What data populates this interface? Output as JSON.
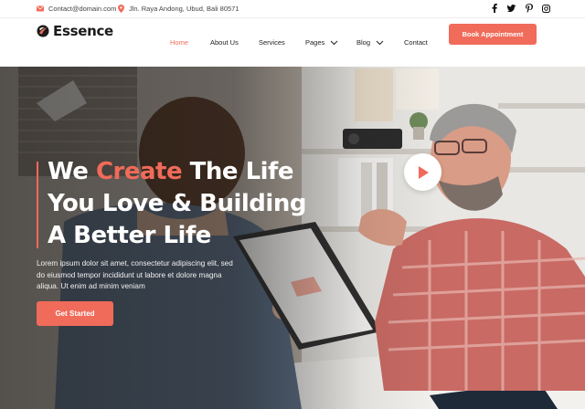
{
  "topbar": {
    "email": "Contact@domain.com",
    "address": "Jln. Raya Andong, Ubud, Bali 80571",
    "social": [
      "facebook-icon",
      "twitter-icon",
      "pinterest-icon",
      "instagram-icon"
    ]
  },
  "header": {
    "logo_text": "Essence",
    "nav": {
      "home": "Home",
      "about": "About Us",
      "services": "Services",
      "pages": "Pages",
      "blog": "Blog",
      "contact": "Contact"
    },
    "cta_label": "Book Appointment"
  },
  "hero": {
    "headline_line1_before": "We ",
    "headline_highlight": "Create",
    "headline_line1_after": " The Life",
    "headline_line2": "You Love & Building",
    "headline_line3": "A Better Life",
    "lead_text": "Lorem ipsum dolor sit amet, consectetur adipiscing elit, sed do eiusmod tempor incididunt ut labore et dolore magna aliqua. Ut enim ad minim veniam",
    "button_label": "Get Started"
  },
  "colors": {
    "accent": "#f06b5a",
    "text_dark": "#1a1a1a"
  }
}
